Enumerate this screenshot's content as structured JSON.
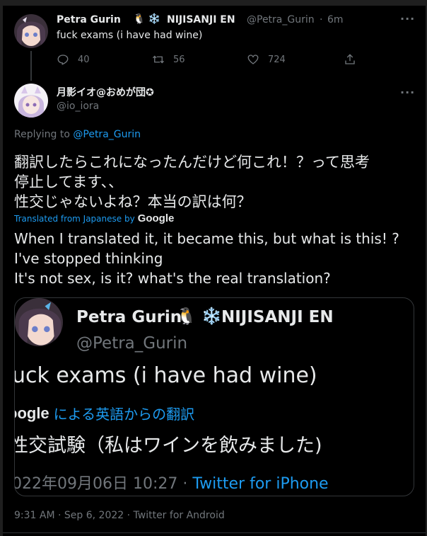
{
  "parent_tweet": {
    "display_name": "Petra Gurin",
    "badge_emojis": "🐧 ❄️",
    "org": "NIJISANJI EN",
    "handle": "@Petra_Gurin",
    "separator": "·",
    "time": "6m",
    "text": "fuck exams (i have had wine)",
    "more_label": "···",
    "actions": {
      "reply_count": "40",
      "retweet_count": "56",
      "like_count": "724"
    }
  },
  "main_tweet": {
    "display_name": "月影イオ@おめが団✪",
    "handle": "@io_iora",
    "more_label": "···",
    "replying_prefix": "Replying to ",
    "replying_handle": "@Petra_Gurin",
    "text_lines": [
      "翻訳したらこれになったんだけど何これ！？って思考",
      "停止してます、、",
      "性交じゃないよね？本当の訳は何？"
    ],
    "translated_label": "Translated from Japanese by",
    "translated_brand": "Google",
    "translation_lines": [
      "When I translated it, it became this, but what is this! ?",
      "I've stopped thinking",
      "It's not sex, is it? what's the real translation?"
    ],
    "footer": "9:31 AM · Sep 6, 2022 · Twitter for Android"
  },
  "embedded_card": {
    "display_name": "Petra Gurin",
    "badge_emojis": "🐧 ❄️",
    "org": "NIJISANJI EN",
    "handle": "@Petra_Gurin",
    "text": "uck exams (i have had wine)",
    "translated_brand": "oogle",
    "translated_label": "による英語からの翻訳",
    "translation_text": "性交試験（私はワインを飲みました)",
    "meta_date": "022年09月06日 10:27 · ",
    "meta_source": "Twitter for iPhone"
  },
  "colors": {
    "background": "#000000",
    "text": "#e7e9ea",
    "muted": "#71767b",
    "accent": "#1d9bf0",
    "border": "#333639"
  },
  "icons": {
    "reply": "reply-icon",
    "retweet": "retweet-icon",
    "like": "heart-icon",
    "share": "share-icon",
    "more": "more-icon"
  }
}
